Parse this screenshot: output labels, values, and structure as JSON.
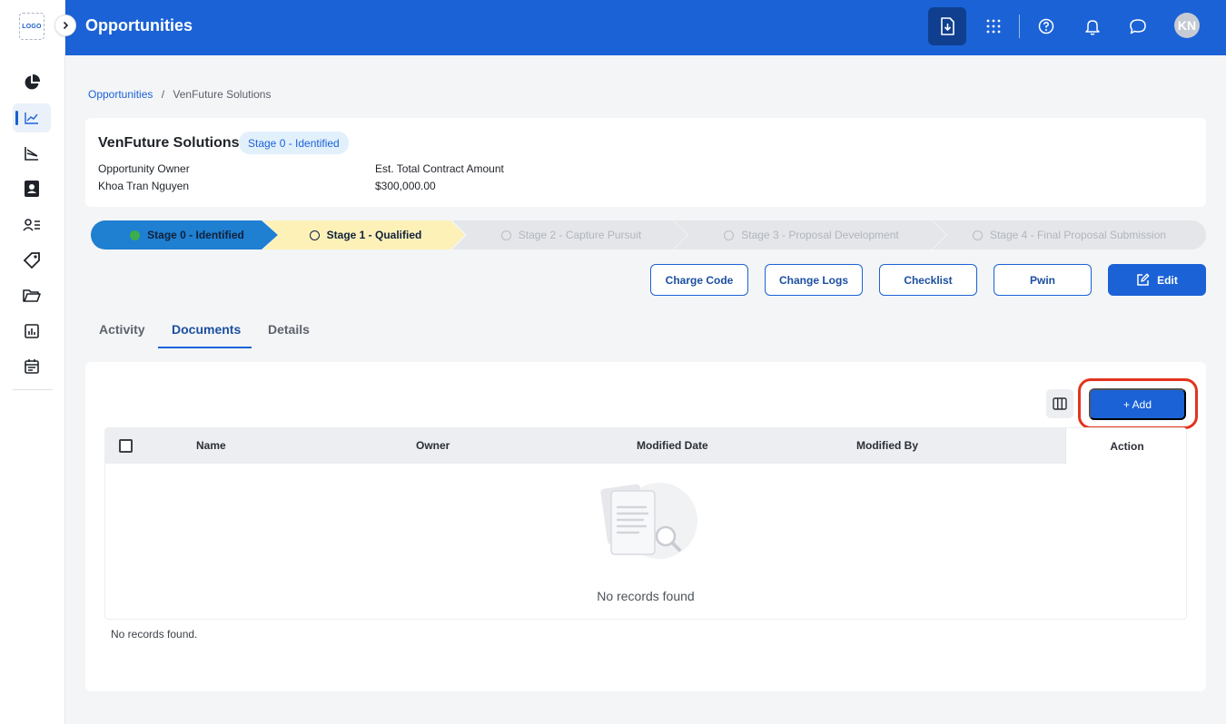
{
  "sidebar": {
    "logo_text": "LOGO",
    "items": [
      {
        "name": "dashboard",
        "icon": "pie-chart-icon",
        "active": false
      },
      {
        "name": "opportunities",
        "icon": "trend-line-icon",
        "active": true
      },
      {
        "name": "pipeline",
        "icon": "funnel-chart-icon",
        "active": false
      },
      {
        "name": "contacts",
        "icon": "contact-card-icon",
        "active": false
      },
      {
        "name": "users",
        "icon": "user-list-icon",
        "active": false
      },
      {
        "name": "deals",
        "icon": "tag-icon",
        "active": false
      },
      {
        "name": "files",
        "icon": "folder-icon",
        "active": false
      },
      {
        "name": "reports",
        "icon": "bar-chart-icon",
        "active": false
      },
      {
        "name": "calendar",
        "icon": "calendar-icon",
        "active": false
      }
    ]
  },
  "header": {
    "title": "Opportunities",
    "avatar_initials": "KN",
    "icons": [
      "download-icon",
      "apps-grid-icon",
      "help-icon",
      "bell-icon",
      "chat-icon"
    ]
  },
  "breadcrumb": {
    "parent": "Opportunities",
    "separator": "/",
    "current": "VenFuture Solutions"
  },
  "summary": {
    "name": "VenFuture Solutions",
    "stage_badge": "Stage 0 - Identified",
    "owner_label": "Opportunity Owner",
    "owner_value": "Khoa Tran Nguyen",
    "amount_label": "Est. Total Contract Amount",
    "amount_value": "$300,000.00"
  },
  "stages": [
    {
      "label": "Stage 0 - Identified",
      "state": "complete"
    },
    {
      "label": "Stage 1 - Qualified",
      "state": "current"
    },
    {
      "label": "Stage 2 - Capture Pursuit",
      "state": "pending"
    },
    {
      "label": "Stage 3 - Proposal Development",
      "state": "pending"
    },
    {
      "label": "Stage 4 - Final Proposal Submission",
      "state": "pending"
    }
  ],
  "actions": {
    "charge_code": "Charge Code",
    "change_logs": "Change Logs",
    "checklist": "Checklist",
    "pwin": "Pwin",
    "edit": "Edit"
  },
  "tabs": [
    {
      "label": "Activity",
      "active": false
    },
    {
      "label": "Documents",
      "active": true
    },
    {
      "label": "Details",
      "active": false
    }
  ],
  "documents": {
    "add_label": "+ Add",
    "columns": [
      "Name",
      "Owner",
      "Modified Date",
      "Modified By",
      "Action"
    ],
    "rows": [],
    "empty_text": "No records found",
    "footer_text": "No records found."
  },
  "colors": {
    "primary": "#1b62d6",
    "stage_complete": "#1f7fd1",
    "stage_current": "#fdf1b8",
    "stage_pending": "#e4e6ea",
    "highlight": "#e3341e"
  }
}
